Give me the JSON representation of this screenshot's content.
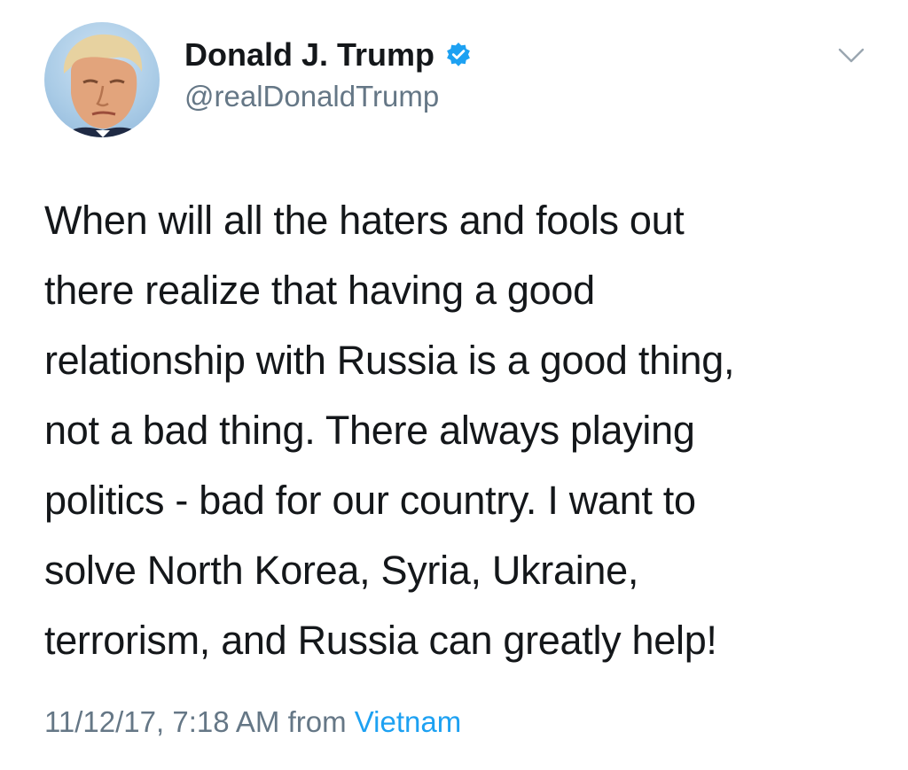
{
  "author": {
    "display_name": "Donald J. Trump",
    "handle": "@realDonaldTrump",
    "verified": true,
    "avatar_icon": "profile-photo",
    "verified_icon": "verified-badge-icon",
    "verified_color": "#1da1f2"
  },
  "tweet": {
    "lines": [
      "When will all the haters and fools out",
      "there realize that having a good",
      "relationship with Russia is a good thing,",
      "not a bad thing. There always playing",
      "politics - bad for our country. I want to",
      "solve North Korea, Syria, Ukraine,",
      "terrorism, and Russia can greatly help!"
    ]
  },
  "meta": {
    "timestamp": "11/12/17, 7:18 AM",
    "from_label": "from",
    "source": "Vietnam"
  },
  "menu": {
    "icon": "chevron-down-icon"
  },
  "colors": {
    "text": "#14171a",
    "secondary": "#657786",
    "link": "#1da1f2"
  }
}
